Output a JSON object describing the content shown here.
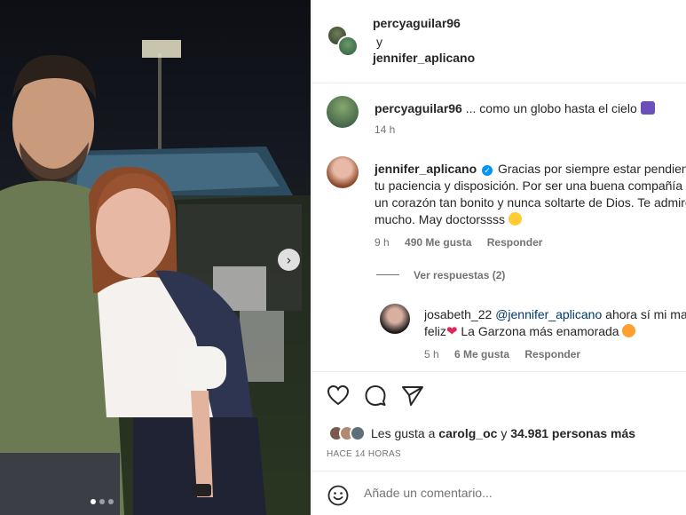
{
  "photo": {
    "next_icon": "chevron-right-icon",
    "carousel_dots": 3,
    "active_dot": 0
  },
  "header": {
    "user1": "percyaguilar96",
    "conjunction": "y",
    "user2": "jennifer_aplicano"
  },
  "caption": {
    "username": "percyaguilar96",
    "text": "... como un globo hasta el cielo",
    "time": "14 h"
  },
  "comments": [
    {
      "username": "jennifer_aplicano",
      "verified": true,
      "lines": [
        "Gracias por siempre estar pendiente de mí y por",
        "tu paciencia y disposición. Por ser una buena compañía y tener",
        "un corazón tan bonito y nunca soltarte de Dios. Te admiro",
        "mucho. May doctorssss"
      ],
      "time": "9 h",
      "likes": "490 Me gusta",
      "reply": "Responder"
    }
  ],
  "view_replies": "Ver respuestas (2)",
  "reply": {
    "username": "josabeth_22",
    "mention": "@jennifer_aplicano",
    "text_line1_rest": "ahora sí mi mamá está",
    "line2_a": "feliz",
    "line2_b": "La Garzona más enamorada",
    "time": "5 h",
    "likes": "6 Me gusta",
    "reply": "Responder"
  },
  "actions": {
    "icons": [
      "heart-icon",
      "comment-icon",
      "share-icon"
    ],
    "likes_prefix": "Les gusta a",
    "likes_user": "carolg_oc",
    "likes_mid": "y",
    "likes_count": "34.981 personas más",
    "time_ago": "HACE 14 HORAS"
  },
  "comment_input": {
    "placeholder": "Añade un comentario..."
  },
  "colors": {
    "link": "#00376b",
    "muted": "#737373",
    "verified": "#0095f6",
    "divider": "#efefef"
  }
}
